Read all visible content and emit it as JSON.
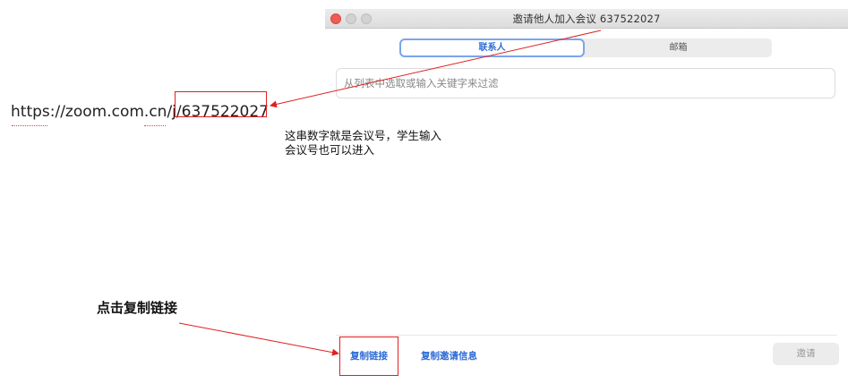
{
  "window": {
    "title": "邀请他人加入会议 637522027",
    "tabs": [
      {
        "label": "联系人",
        "active": true
      },
      {
        "label": "邮箱",
        "active": false
      }
    ],
    "search": {
      "placeholder": "从列表中选取或输入关键字来过滤",
      "value": ""
    },
    "footer": {
      "copy_link_label": "复制链接",
      "copy_invite_label": "复制邀请信息",
      "invite_label": "邀请"
    }
  },
  "annotations": {
    "url": "https://zoom.com.cn/j/637522027",
    "note": "这串数字就是会议号，学生输入会议号也可以进入",
    "instruction": "点击复制链接"
  },
  "colors": {
    "accent": "#2d6bd5",
    "annotation_red": "#e02020",
    "close_button": "#ee5c53"
  }
}
